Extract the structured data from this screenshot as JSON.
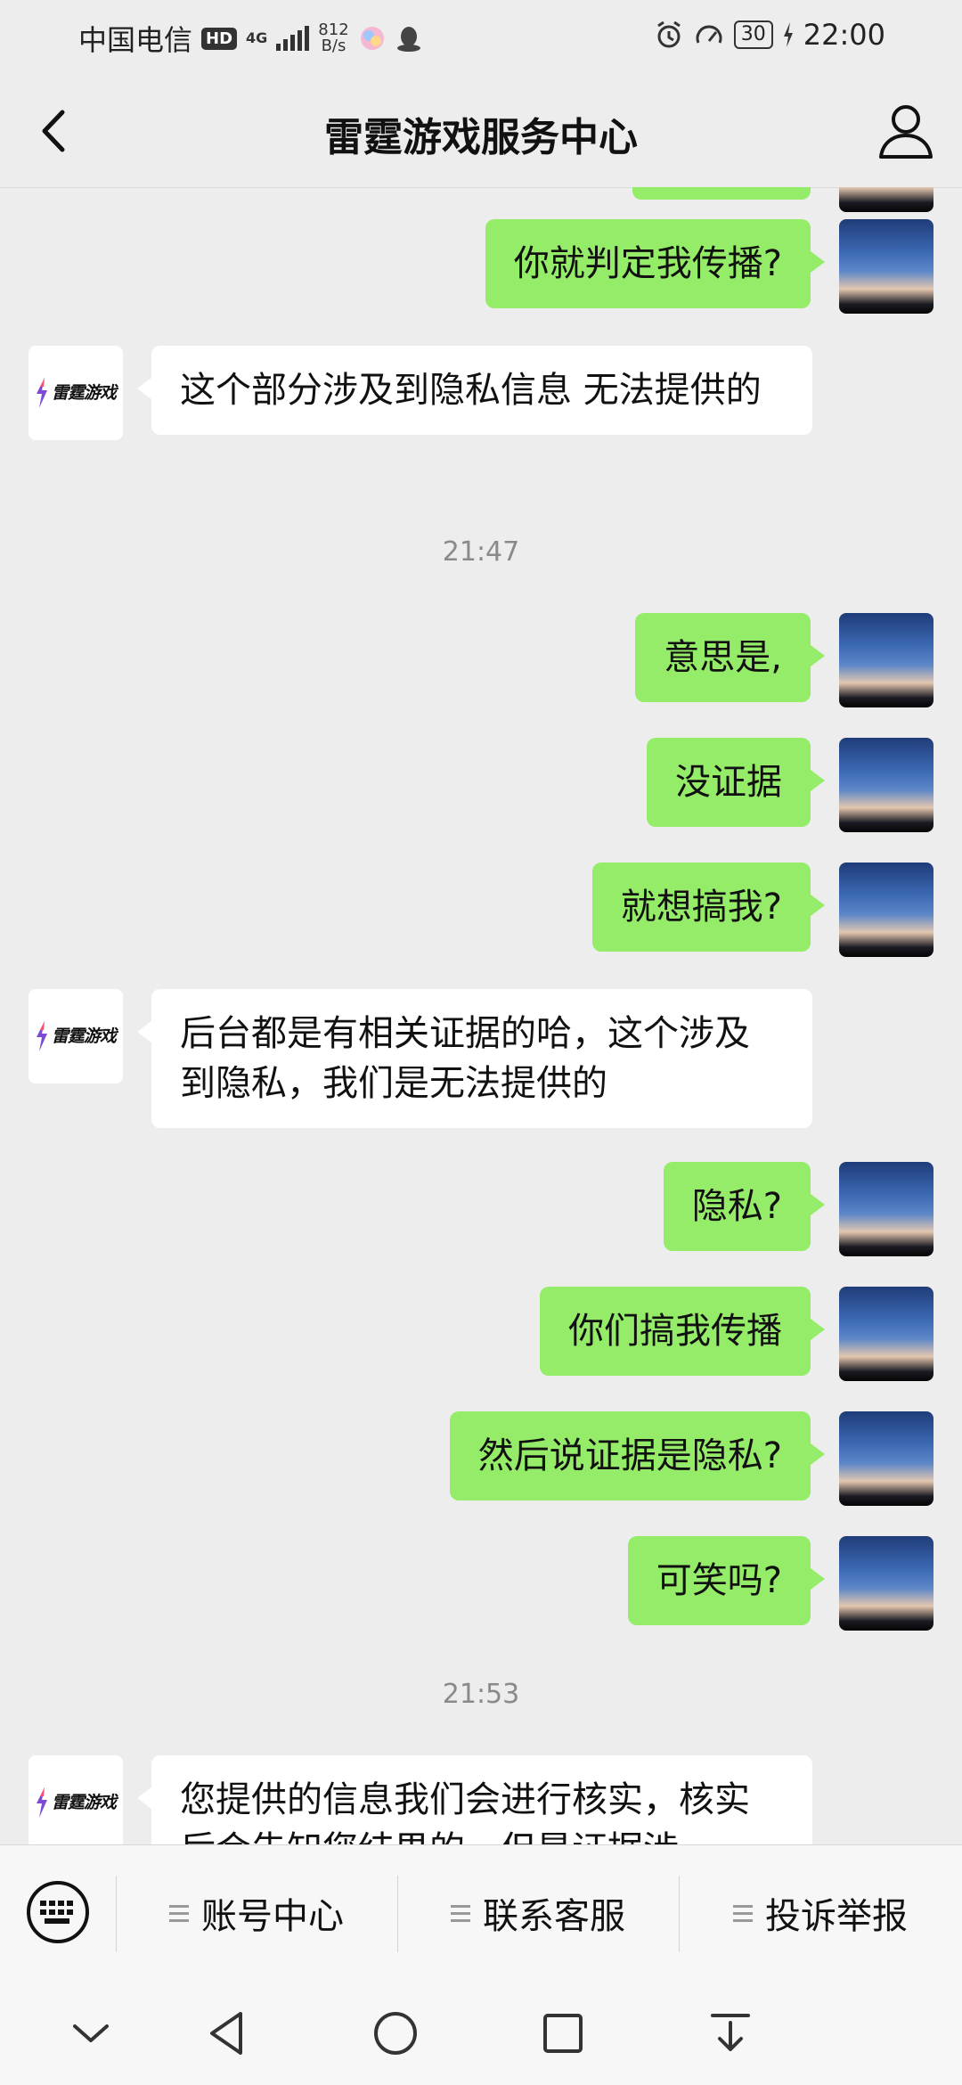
{
  "status_bar": {
    "carrier": "中国电信",
    "hd_badge": "HD",
    "network": "4G",
    "speed_value": "812",
    "speed_unit": "B/s",
    "battery": "30",
    "time": "22:00"
  },
  "header": {
    "title": "雷霆游戏服务中心"
  },
  "bot": {
    "logo_text": "雷霆游戏"
  },
  "messages": [
    {
      "text": "你就判定我传播?"
    },
    {
      "text": "这个部分涉及到隐私信息 无法提供的"
    },
    {
      "time": "21:47"
    },
    {
      "text": "意思是,"
    },
    {
      "text": "没证据"
    },
    {
      "text": "就想搞我?"
    },
    {
      "text": "后台都是有相关证据的哈，这个涉及到隐私，我们是无法提供的"
    },
    {
      "text": "隐私?"
    },
    {
      "text": "你们搞我传播"
    },
    {
      "text": "然后说证据是隐私?"
    },
    {
      "text": "可笑吗?"
    },
    {
      "time": "21:53"
    },
    {
      "text": "您提供的信息我们会进行核实，核实后会告知您结果的，但是证据涉"
    }
  ],
  "menu": {
    "items": [
      "账号中心",
      "联系客服",
      "投诉举报"
    ]
  },
  "colors": {
    "my_bubble": "#95ec69",
    "bot_bubble": "#ffffff",
    "background": "#ededed"
  }
}
